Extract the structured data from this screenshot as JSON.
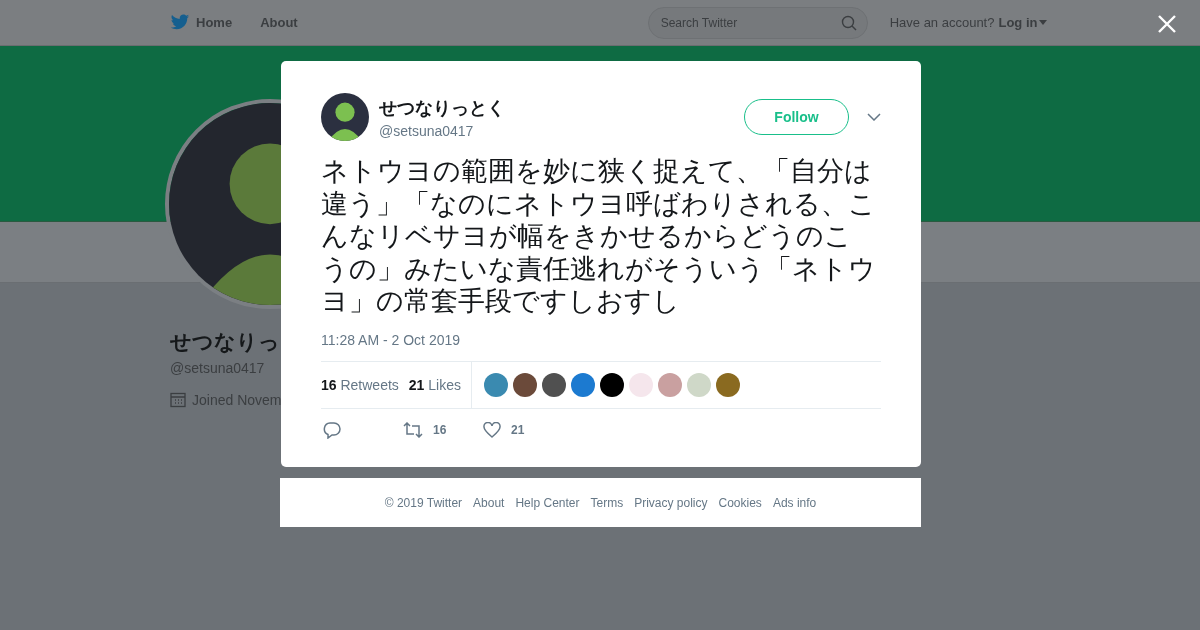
{
  "nav": {
    "home": "Home",
    "about": "About",
    "search": {
      "placeholder": "Search Twitter"
    },
    "account_prompt": "Have an account?",
    "login": "Log in"
  },
  "profile": {
    "name": "せつなりっ",
    "handle": "@setsuna0417",
    "joined": "Joined Novem"
  },
  "tweet": {
    "name": "せつなりっとく",
    "handle": "@setsuna0417",
    "follow": "Follow",
    "text": "ネトウヨの範囲を妙に狭く捉えて、「自分は違う」「なのにネトウヨ呼ばわりされる、こんなリベサヨが幅をきかせるからどうのこうの」みたいな責任逃れがそういう「ネトウヨ」の常套手段ですしおすし",
    "time": "11:28 AM - 2 Oct 2019",
    "stats": [
      {
        "count": "16",
        "label": "Retweets"
      },
      {
        "count": "21",
        "label": "Likes"
      }
    ],
    "likers": [
      {
        "kind": "avatar"
      },
      {
        "kind": "avatar"
      },
      {
        "kind": "avatar"
      },
      {
        "kind": "avatar"
      },
      {
        "kind": "avatar"
      },
      {
        "kind": "avatar"
      },
      {
        "kind": "avatar"
      },
      {
        "kind": "avatar"
      },
      {
        "kind": "avatar"
      }
    ],
    "actions": [
      {
        "kind": "reply"
      },
      {
        "kind": "retweet",
        "count": "16"
      },
      {
        "kind": "like",
        "count": "21"
      }
    ]
  },
  "footer": [
    "© 2019 Twitter",
    "About",
    "Help Center",
    "Terms",
    "Privacy policy",
    "Cookies",
    "Ads info"
  ]
}
